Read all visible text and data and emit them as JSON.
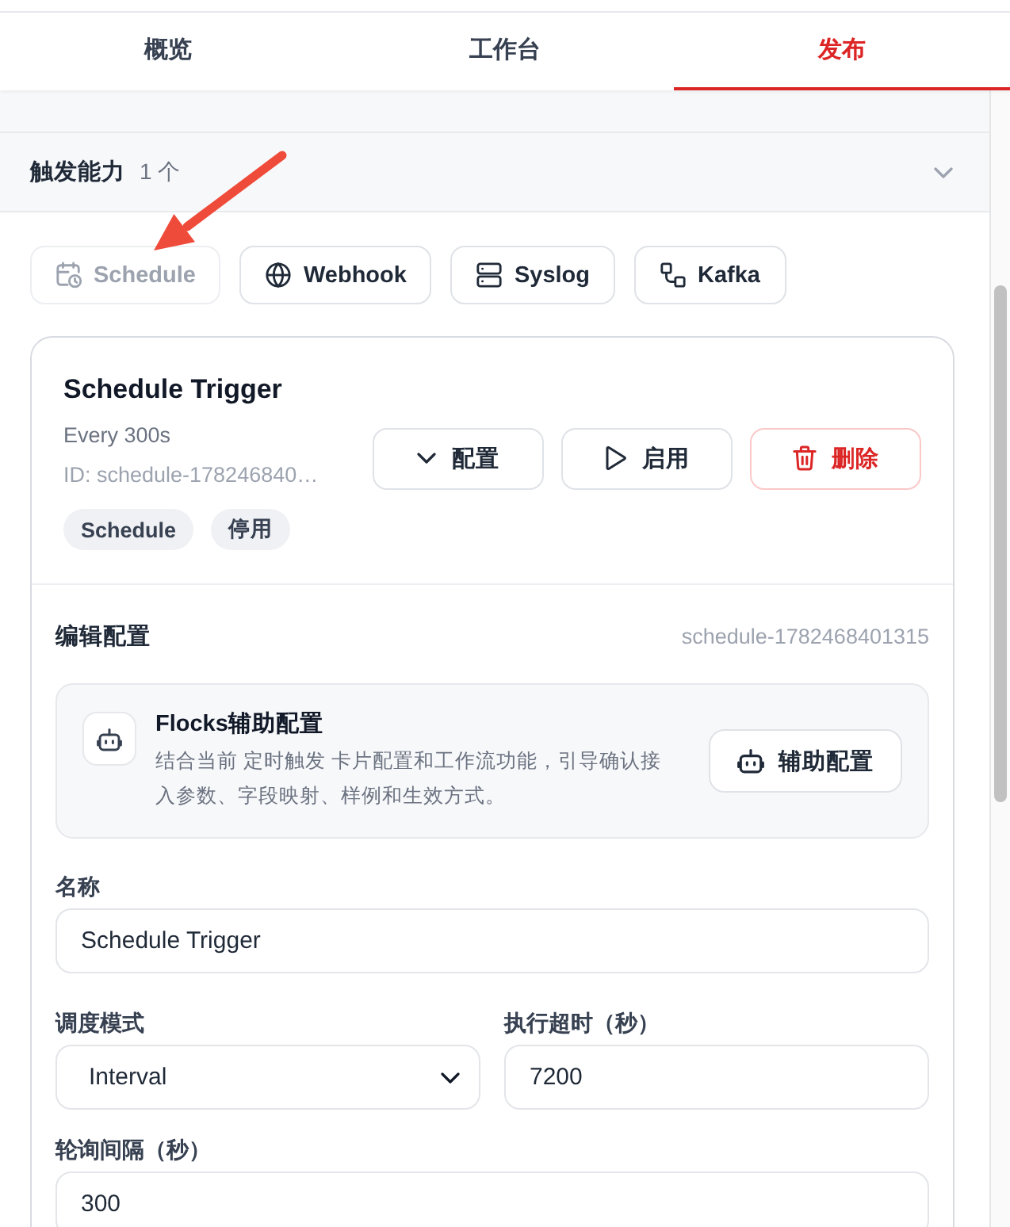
{
  "tabs": [
    {
      "label": "概览",
      "selected": false
    },
    {
      "label": "工作台",
      "selected": false
    },
    {
      "label": "发布",
      "selected": true
    }
  ],
  "section": {
    "title": "触发能力",
    "count": "1 个",
    "expanded": true
  },
  "trigger_types": [
    {
      "label": "Schedule",
      "kind": "schedule",
      "disabled": true
    },
    {
      "label": "Webhook",
      "kind": "webhook",
      "disabled": false
    },
    {
      "label": "Syslog",
      "kind": "syslog",
      "disabled": false
    },
    {
      "label": "Kafka",
      "kind": "kafka",
      "disabled": false
    }
  ],
  "trigger_card": {
    "title": "Schedule Trigger",
    "summary": "Every 300s",
    "id": "ID: schedule-178246840…",
    "actions": [
      {
        "label": "配置",
        "kind": "expand"
      },
      {
        "label": "启用",
        "kind": "start"
      },
      {
        "label": "删除",
        "kind": "delete"
      }
    ],
    "tags": [
      "Schedule",
      "停用"
    ]
  },
  "editor": {
    "title": "编辑配置",
    "id": "schedule-1782468401315",
    "assistant": {
      "title": "Flocks辅助配置",
      "description": "结合当前 定时触发 卡片配置和工作流功能，引导确认接入参数、字段映射、样例和生效方式。",
      "button": "辅助配置"
    },
    "field_rows": [
      [
        {
          "label": "名称",
          "kind": "text",
          "value": "Schedule Trigger"
        }
      ],
      [
        {
          "label": "调度模式",
          "kind": "select",
          "value": "Interval"
        },
        {
          "label": "执行超时（秒）",
          "kind": "text",
          "value": "7200"
        }
      ],
      [
        {
          "label": "轮询间隔（秒）",
          "kind": "text",
          "value": "300"
        }
      ]
    ]
  }
}
